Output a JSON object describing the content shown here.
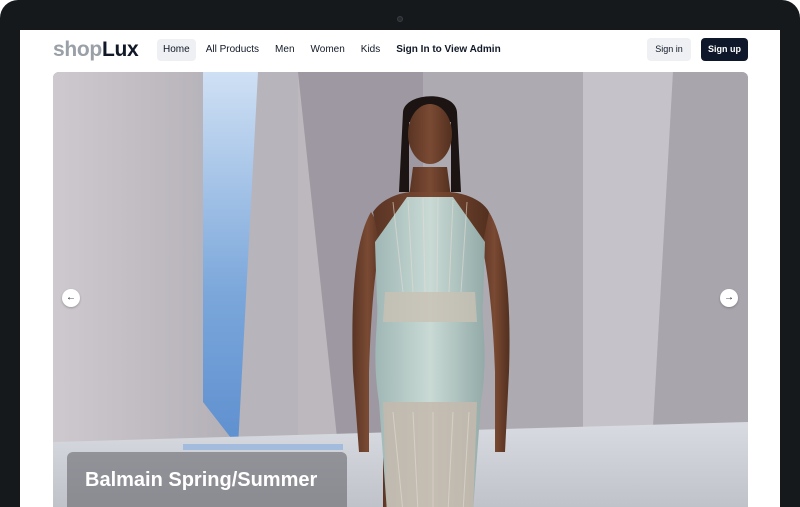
{
  "brand": {
    "part1": "shop",
    "part2": "Lux"
  },
  "nav": {
    "links": [
      {
        "label": "Home",
        "active": true
      },
      {
        "label": "All Products"
      },
      {
        "label": "Men"
      },
      {
        "label": "Women"
      },
      {
        "label": "Kids"
      },
      {
        "label": "Sign In to View Admin"
      }
    ],
    "signin_label": "Sign in",
    "signup_label": "Sign up"
  },
  "hero": {
    "caption": "Balmain Spring/Summer",
    "prev_icon": "arrow-left-icon",
    "next_icon": "arrow-right-icon"
  },
  "colors": {
    "primary": "#0f172a",
    "nav_active_bg": "#eef0f3",
    "frame": "#16191c"
  }
}
